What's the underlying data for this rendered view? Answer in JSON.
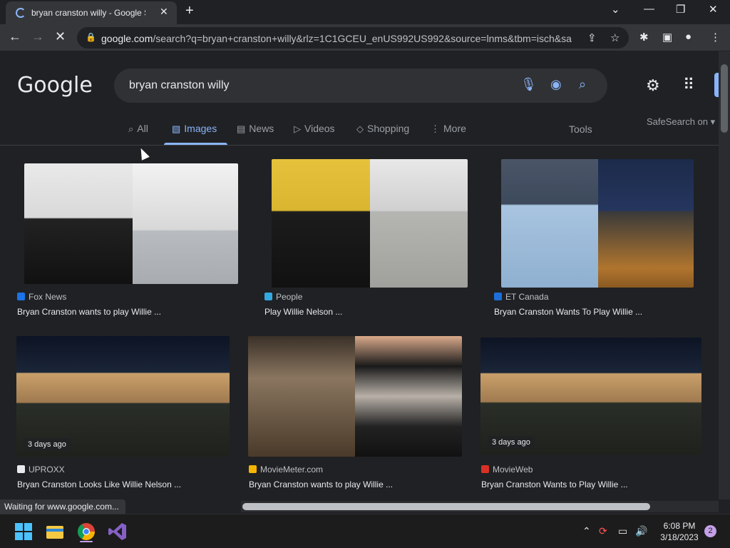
{
  "browser": {
    "tab_title": "bryan cranston willy - Google Search",
    "url_host": "google.com",
    "url_rest": "/search?q=bryan+cranston+willy&rlz=1C1GCEU_enUS992US992&source=lnms&tbm=isch&sa...",
    "status_text": "Waiting for www.google.com..."
  },
  "google": {
    "logo": "Google",
    "query": "bryan cranston willy",
    "tabs": [
      {
        "label": "All",
        "icon": "search-icon"
      },
      {
        "label": "Images",
        "icon": "image-icon",
        "active": true
      },
      {
        "label": "News",
        "icon": "news-icon"
      },
      {
        "label": "Videos",
        "icon": "video-icon"
      },
      {
        "label": "Shopping",
        "icon": "tag-icon"
      },
      {
        "label": "More",
        "icon": "more-vert-icon"
      }
    ],
    "tools_label": "Tools",
    "safesearch_label": "SafeSearch on"
  },
  "results": [
    {
      "source": "Fox News",
      "title": "Bryan Cranston wants to play Willie ...",
      "badge": "",
      "fav_color": "#1a73e8"
    },
    {
      "source": "People",
      "title": "Play Willie Nelson ...",
      "badge": "",
      "fav_color": "#34a8e0"
    },
    {
      "source": "ET Canada",
      "title": "Bryan Cranston Wants To Play Willie ...",
      "badge": "",
      "fav_color": "#1e6fd9"
    },
    {
      "source": "UPROXX",
      "title": "Bryan Cranston Looks Like Willie Nelson ...",
      "badge": "3 days ago",
      "fav_color": "#e8eaed"
    },
    {
      "source": "MovieMeter.com",
      "title": "Bryan Cranston wants to play Willie ...",
      "badge": "",
      "fav_color": "#f4b400"
    },
    {
      "source": "MovieWeb",
      "title": "Bryan Cranston Wants to Play Willie ...",
      "badge": "3 days ago",
      "fav_color": "#d93025"
    }
  ],
  "taskbar": {
    "time": "6:08 PM",
    "date": "3/18/2023",
    "notifications": "2"
  },
  "colors": {
    "accent": "#8ab4f8",
    "page_bg": "#202124"
  }
}
